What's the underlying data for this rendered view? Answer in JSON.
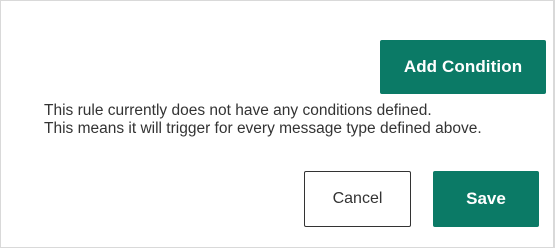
{
  "dialog": {
    "add_condition_label": "Add Condition",
    "message_line1": "This rule currently does not have any conditions defined.",
    "message_line2": "This means it will trigger for every message type defined above.",
    "cancel_label": "Cancel",
    "save_label": "Save"
  },
  "colors": {
    "accent": "#0b7a66",
    "text": "#333333",
    "border": "#d9d9d9"
  }
}
